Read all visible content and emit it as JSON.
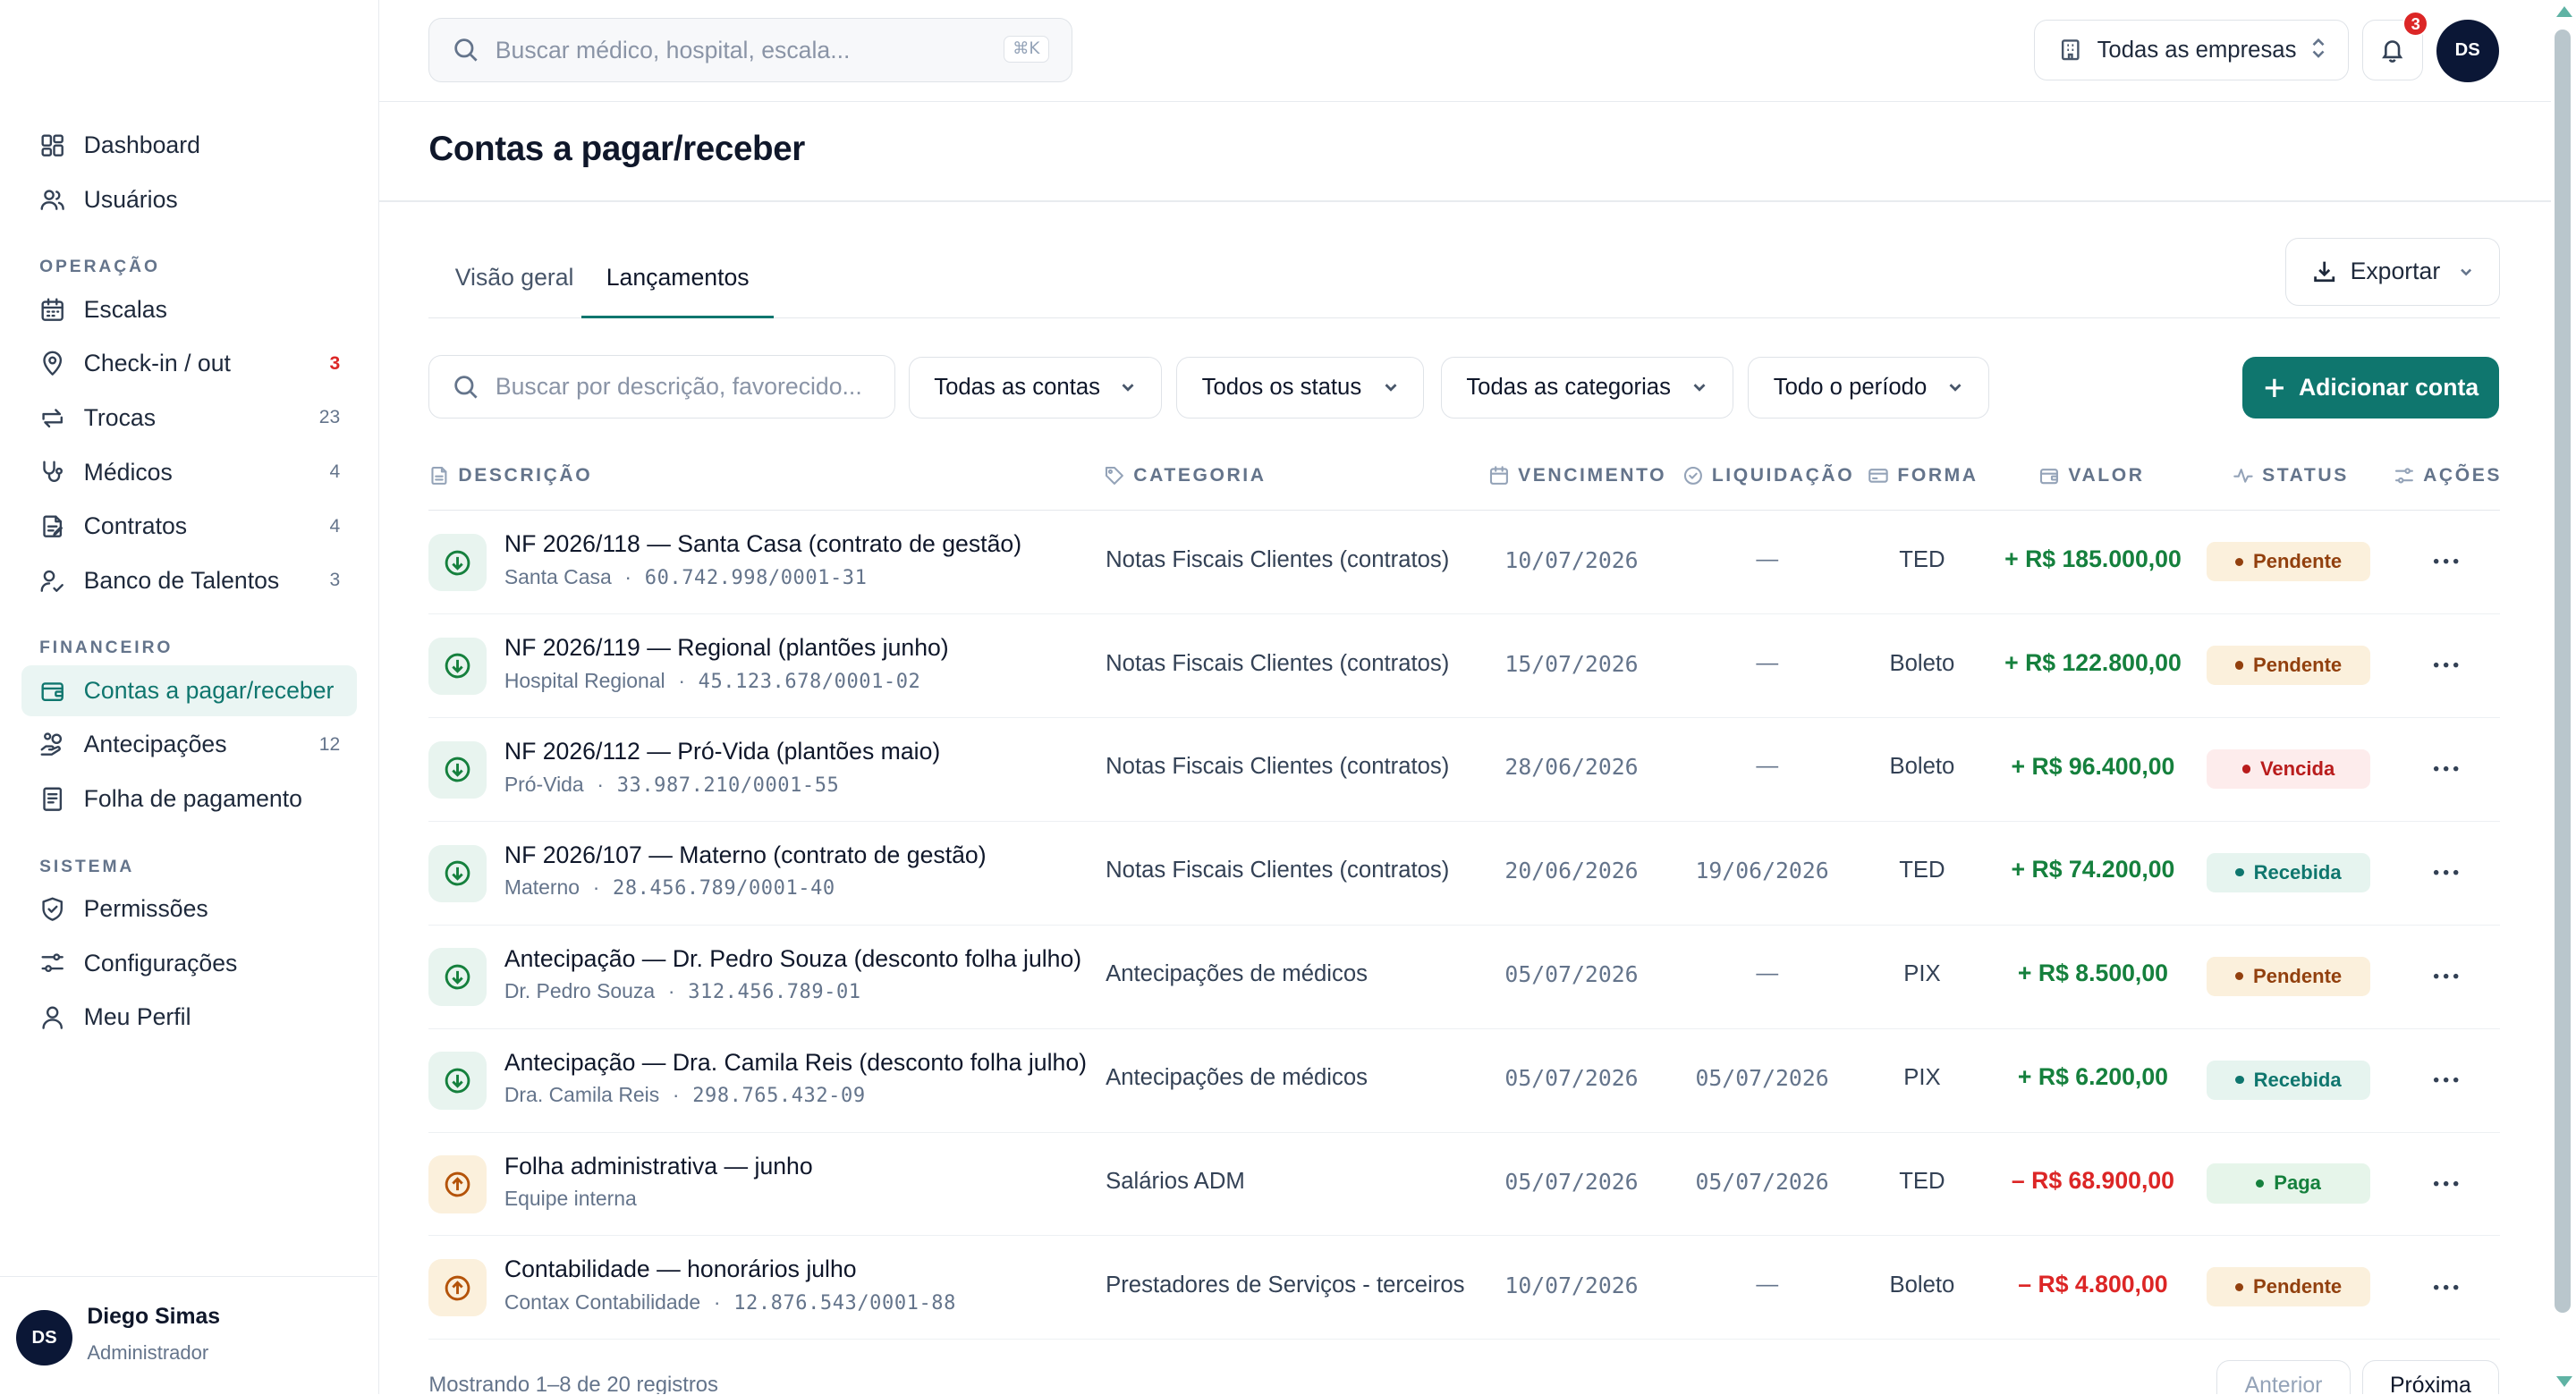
{
  "topbar": {
    "search_placeholder": "Buscar médico, hospital, escala...",
    "shortcut": "⌘K",
    "company_selector": "Todas as empresas",
    "notification_count": "3",
    "avatar_initials": "DS"
  },
  "sidebar": {
    "main_items": [
      {
        "label": "Dashboard",
        "icon": "dashboard-icon"
      },
      {
        "label": "Usuários",
        "icon": "users-icon"
      }
    ],
    "sections": [
      {
        "title": "OPERAÇÃO",
        "items": [
          {
            "label": "Escalas",
            "count": "",
            "icon": "calendar-icon"
          },
          {
            "label": "Check-in / out",
            "count": "3",
            "icon": "location-pin-icon"
          },
          {
            "label": "Trocas",
            "count": "23",
            "icon": "swap-icon"
          },
          {
            "label": "Médicos",
            "count": "4",
            "icon": "stethoscope-icon"
          },
          {
            "label": "Contratos",
            "count": "4",
            "icon": "contract-icon"
          },
          {
            "label": "Banco de Talentos",
            "count": "3",
            "icon": "talent-icon"
          }
        ]
      },
      {
        "title": "FINANCEIRO",
        "items": [
          {
            "label": "Contas a pagar/receber",
            "count": "",
            "icon": "wallet-icon",
            "active": true
          },
          {
            "label": "Antecipações",
            "count": "12",
            "icon": "hand-coins-icon"
          },
          {
            "label": "Folha de pagamento",
            "count": "",
            "icon": "receipt-icon"
          }
        ]
      },
      {
        "title": "SISTEMA",
        "items": [
          {
            "label": "Permissões",
            "count": "",
            "icon": "shield-icon"
          },
          {
            "label": "Configurações",
            "count": "",
            "icon": "sliders-icon"
          },
          {
            "label": "Meu Perfil",
            "count": "",
            "icon": "user-icon"
          }
        ]
      }
    ],
    "user": {
      "initials": "DS",
      "name": "Diego Simas",
      "role": "Administrador"
    }
  },
  "page": {
    "title": "Contas a pagar/receber",
    "tabs": [
      "Visão geral",
      "Lançamentos"
    ],
    "active_tab": 1,
    "export_label": "Exportar",
    "list_search_placeholder": "Buscar por descrição, favorecido...",
    "filters": [
      "Todas as contas",
      "Todos os status",
      "Todas as categorias",
      "Todo o período"
    ],
    "add_button": "Adicionar conta"
  },
  "table": {
    "columns": [
      "DESCRIÇÃO",
      "CATEGORIA",
      "VENCIMENTO",
      "LIQUIDAÇÃO",
      "FORMA",
      "VALOR",
      "STATUS",
      "AÇÕES"
    ],
    "rows": [
      {
        "direction": "in",
        "description": "NF 2026/118 — Santa Casa (contrato de gestão)",
        "party": "Santa Casa",
        "doc": "60.742.998/0001-31",
        "category": "Notas Fiscais Clientes (contratos)",
        "due": "10/07/2026",
        "settled": "—",
        "method": "TED",
        "value": "+ R$ 185.000,00",
        "status": "Pendente"
      },
      {
        "direction": "in",
        "description": "NF 2026/119 — Regional (plantões junho)",
        "party": "Hospital Regional",
        "doc": "45.123.678/0001-02",
        "category": "Notas Fiscais Clientes (contratos)",
        "due": "15/07/2026",
        "settled": "—",
        "method": "Boleto",
        "value": "+ R$ 122.800,00",
        "status": "Pendente"
      },
      {
        "direction": "in",
        "description": "NF 2026/112 — Pró-Vida (plantões maio)",
        "party": "Pró-Vida",
        "doc": "33.987.210/0001-55",
        "category": "Notas Fiscais Clientes (contratos)",
        "due": "28/06/2026",
        "settled": "—",
        "method": "Boleto",
        "value": "+ R$ 96.400,00",
        "status": "Vencida"
      },
      {
        "direction": "in",
        "description": "NF 2026/107 — Materno (contrato de gestão)",
        "party": "Materno",
        "doc": "28.456.789/0001-40",
        "category": "Notas Fiscais Clientes (contratos)",
        "due": "20/06/2026",
        "settled": "19/06/2026",
        "method": "TED",
        "value": "+ R$ 74.200,00",
        "status": "Recebida"
      },
      {
        "direction": "in",
        "description": "Antecipação — Dr. Pedro Souza (desconto folha julho)",
        "party": "Dr. Pedro Souza",
        "doc": "312.456.789-01",
        "category": "Antecipações de médicos",
        "due": "05/07/2026",
        "settled": "—",
        "method": "PIX",
        "value": "+ R$ 8.500,00",
        "status": "Pendente"
      },
      {
        "direction": "in",
        "description": "Antecipação — Dra. Camila Reis (desconto folha julho)",
        "party": "Dra. Camila Reis",
        "doc": "298.765.432-09",
        "category": "Antecipações de médicos",
        "due": "05/07/2026",
        "settled": "05/07/2026",
        "method": "PIX",
        "value": "+ R$ 6.200,00",
        "status": "Recebida"
      },
      {
        "direction": "out",
        "description": "Folha administrativa — junho",
        "party": "Equipe interna",
        "doc": "",
        "category": "Salários ADM",
        "due": "05/07/2026",
        "settled": "05/07/2026",
        "method": "TED",
        "value": "– R$ 68.900,00",
        "status": "Paga"
      },
      {
        "direction": "out",
        "description": "Contabilidade — honorários julho",
        "party": "Contax Contabilidade",
        "doc": "12.876.543/0001-88",
        "category": "Prestadores de Serviços - terceiros",
        "due": "10/07/2026",
        "settled": "—",
        "method": "Boleto",
        "value": "– R$ 4.800,00",
        "status": "Pendente"
      }
    ]
  },
  "footer": {
    "showing": "Mostrando 1–8 de 20 registros",
    "prev": "Anterior",
    "next": "Próxima"
  },
  "colors": {
    "accent": "#0f766e",
    "positive": "#15803d",
    "negative": "#dc2626",
    "pending_bg": "#fbf0dc",
    "overdue_bg": "#fdecec"
  }
}
